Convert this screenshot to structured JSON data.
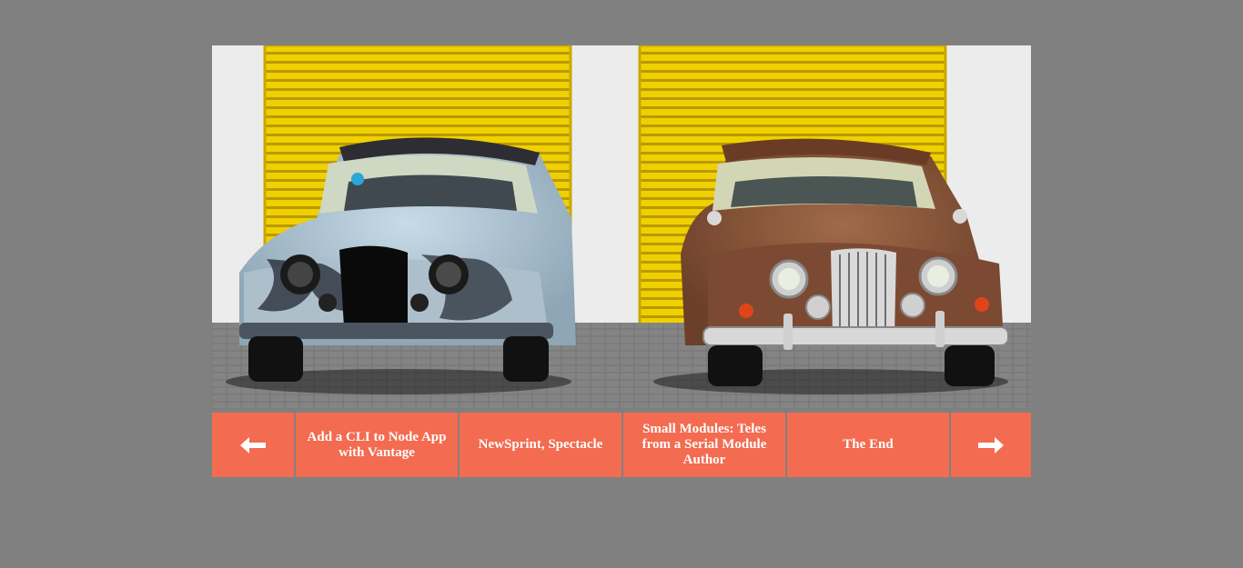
{
  "slider": {
    "image": {
      "alt_icon": "classic-cars-photo"
    },
    "prev_icon": "arrow-left-icon",
    "next_icon": "arrow-right-icon",
    "links": [
      {
        "label": "Add a CLI to Node App with Vantage"
      },
      {
        "label": "NewSprint, Spectacle"
      },
      {
        "label": "Small Modules: Teles from a Serial Module Author"
      },
      {
        "label": "The End"
      }
    ]
  },
  "colors": {
    "page_background": "#808080",
    "nav_background": "#f36b50",
    "nav_text": "#ffffff"
  }
}
